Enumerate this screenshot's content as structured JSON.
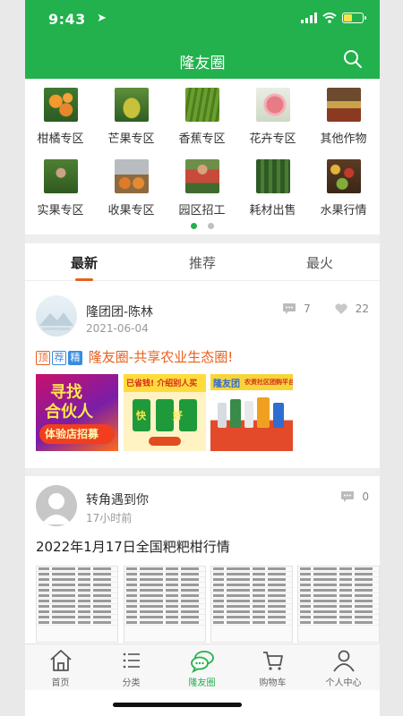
{
  "status": {
    "time": "9:43"
  },
  "header": {
    "title": "隆友圈"
  },
  "categories": [
    {
      "label": "柑橘专区"
    },
    {
      "label": "芒果专区"
    },
    {
      "label": "香蕉专区"
    },
    {
      "label": "花卉专区"
    },
    {
      "label": "其他作物"
    },
    {
      "label": "实果专区"
    },
    {
      "label": "收果专区"
    },
    {
      "label": "园区招工"
    },
    {
      "label": "耗材出售"
    },
    {
      "label": "水果行情"
    }
  ],
  "tabs": [
    {
      "label": "最新"
    },
    {
      "label": "推荐"
    },
    {
      "label": "最火"
    }
  ],
  "posts": [
    {
      "author": "隆团团-陈林",
      "time": "2021-06-04",
      "comments": "7",
      "likes": "22",
      "badges": [
        "顶",
        "荐",
        "精"
      ],
      "title": "隆友圈-共享农业生态圈!",
      "images": [
        {
          "text1": "寻找",
          "text2": "合伙人",
          "text3": "体验店招募"
        },
        {
          "text1": "已省钱! 介绍别人买",
          "text2": "快 好 省",
          "text3": ""
        },
        {
          "text1": "隆友团",
          "text2": "农资社区团购平台",
          "text3": ""
        }
      ]
    },
    {
      "author": "转角遇到你",
      "time": "17小时前",
      "comments": "0",
      "title": "2022年1月17日全国粑粑柑行情"
    }
  ],
  "nav": [
    {
      "label": "首页",
      "icon": "home-icon"
    },
    {
      "label": "分类",
      "icon": "list-icon"
    },
    {
      "label": "隆友圈",
      "icon": "chat-icon"
    },
    {
      "label": "购物车",
      "icon": "cart-icon"
    },
    {
      "label": "个人中心",
      "icon": "person-icon"
    }
  ],
  "colors": {
    "brand": "#22b14c",
    "accent": "#e9601c"
  }
}
